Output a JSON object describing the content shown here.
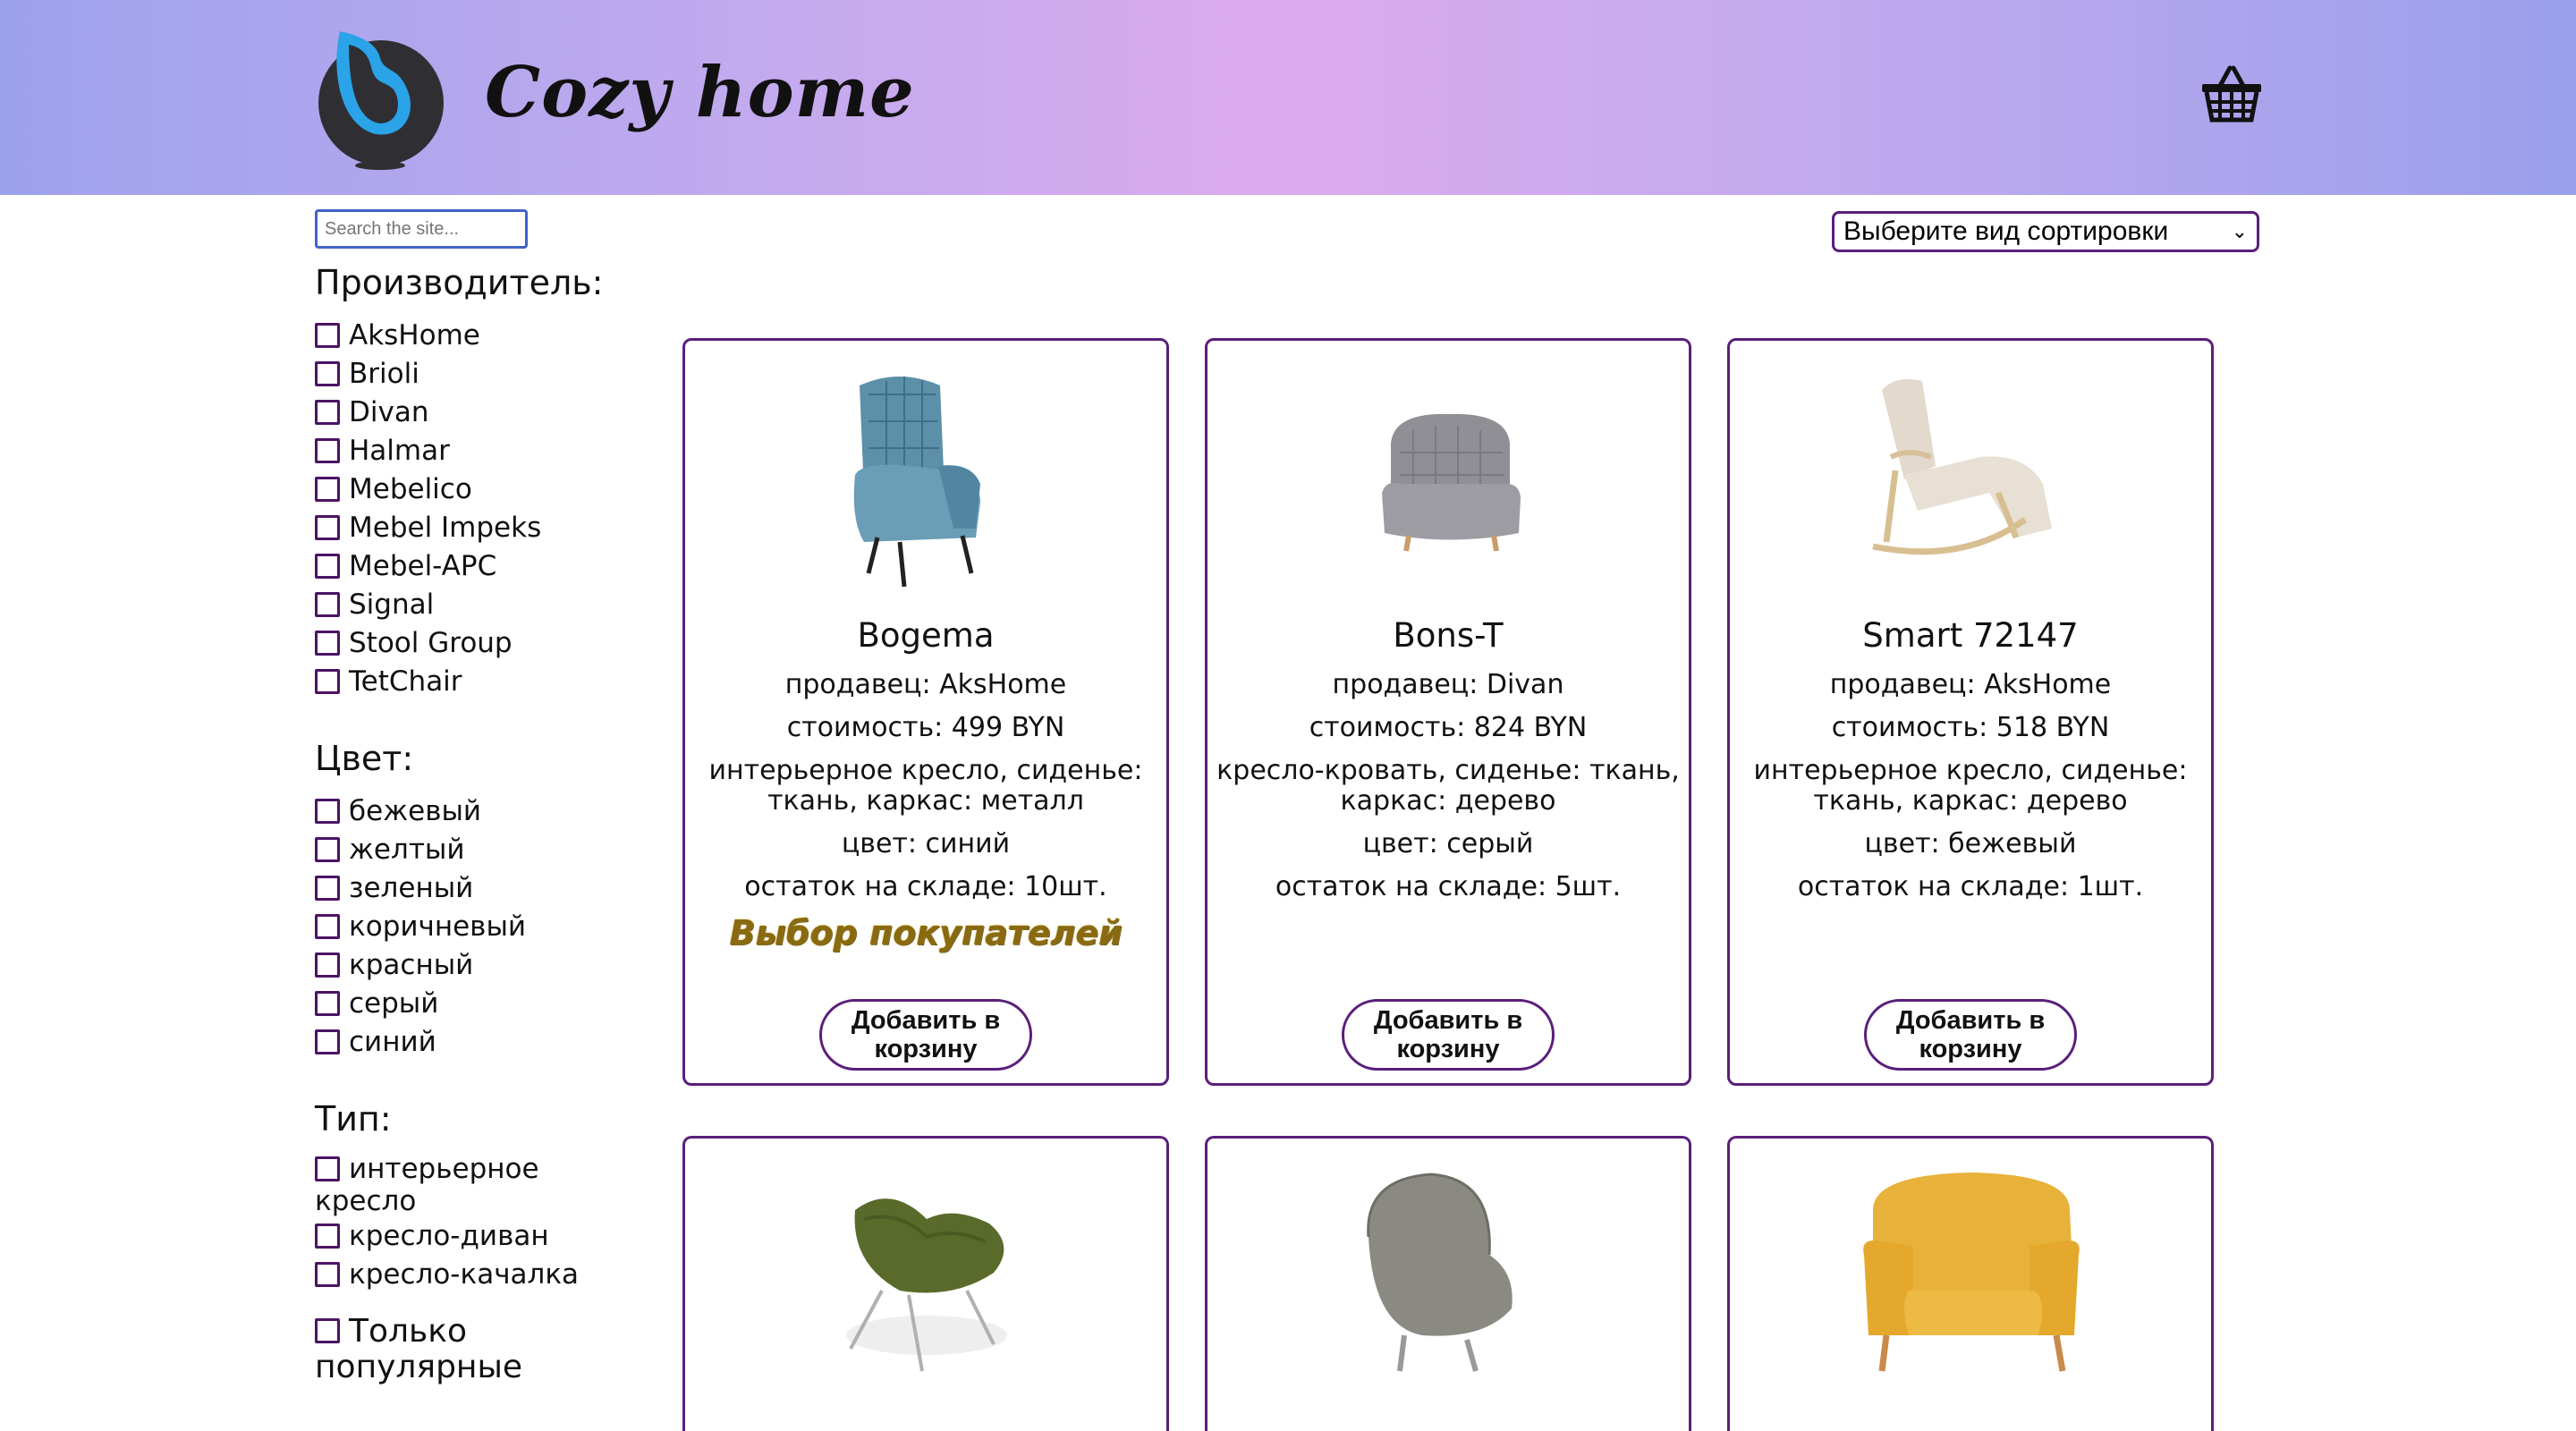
{
  "header": {
    "brand": "Cozy home"
  },
  "search": {
    "placeholder": "Search the site..."
  },
  "sort": {
    "selected": "Выберите вид сортировки"
  },
  "filters": {
    "maker_title": "Производитель:",
    "makers": [
      "AksHome",
      "Brioli",
      "Divan",
      "Halmar",
      "Mebelico",
      "Mebel Impeks",
      "Mebel-APC",
      "Signal",
      "Stool Group",
      "TetChair"
    ],
    "color_title": "Цвет:",
    "colors": [
      "бежевый",
      "желтый",
      "зеленый",
      "коричневый",
      "красный",
      "серый",
      "синий"
    ],
    "type_title": "Тип:",
    "types": [
      "интерьерное кресло",
      "кресло-диван",
      "кресло-качалка"
    ],
    "popular_label": "Только популярные"
  },
  "products": [
    {
      "name": "Bogema",
      "seller": "продавец: AksHome",
      "price": "стоимость: 499 BYN",
      "desc": "интерьерное кресло, сиденье: ткань, каркас: металл",
      "color": "цвет: синий",
      "stock": "остаток на складе: 10шт.",
      "badge": "Выбор покупателей",
      "button": "Добавить в корзину"
    },
    {
      "name": "Bons-T",
      "seller": "продавец: Divan",
      "price": "стоимость: 824 BYN",
      "desc": "кресло-кровать, сиденье: ткань, каркас: дерево",
      "color": "цвет: серый",
      "stock": "остаток на складе: 5шт.",
      "badge": "",
      "button": "Добавить в корзину"
    },
    {
      "name": "Smart 72147",
      "seller": "продавец: AksHome",
      "price": "стоимость: 518 BYN",
      "desc": "интерьерное кресло, сиденье: ткань, каркас: дерево",
      "color": "цвет: бежевый",
      "stock": "остаток на складе: 1шт.",
      "badge": "",
      "button": "Добавить в корзину"
    }
  ],
  "colors": {
    "accent": "#5a1f7a",
    "header_left": "#9da2ec",
    "header_mid": "#dcaaee",
    "badge": "#8a6a10"
  }
}
